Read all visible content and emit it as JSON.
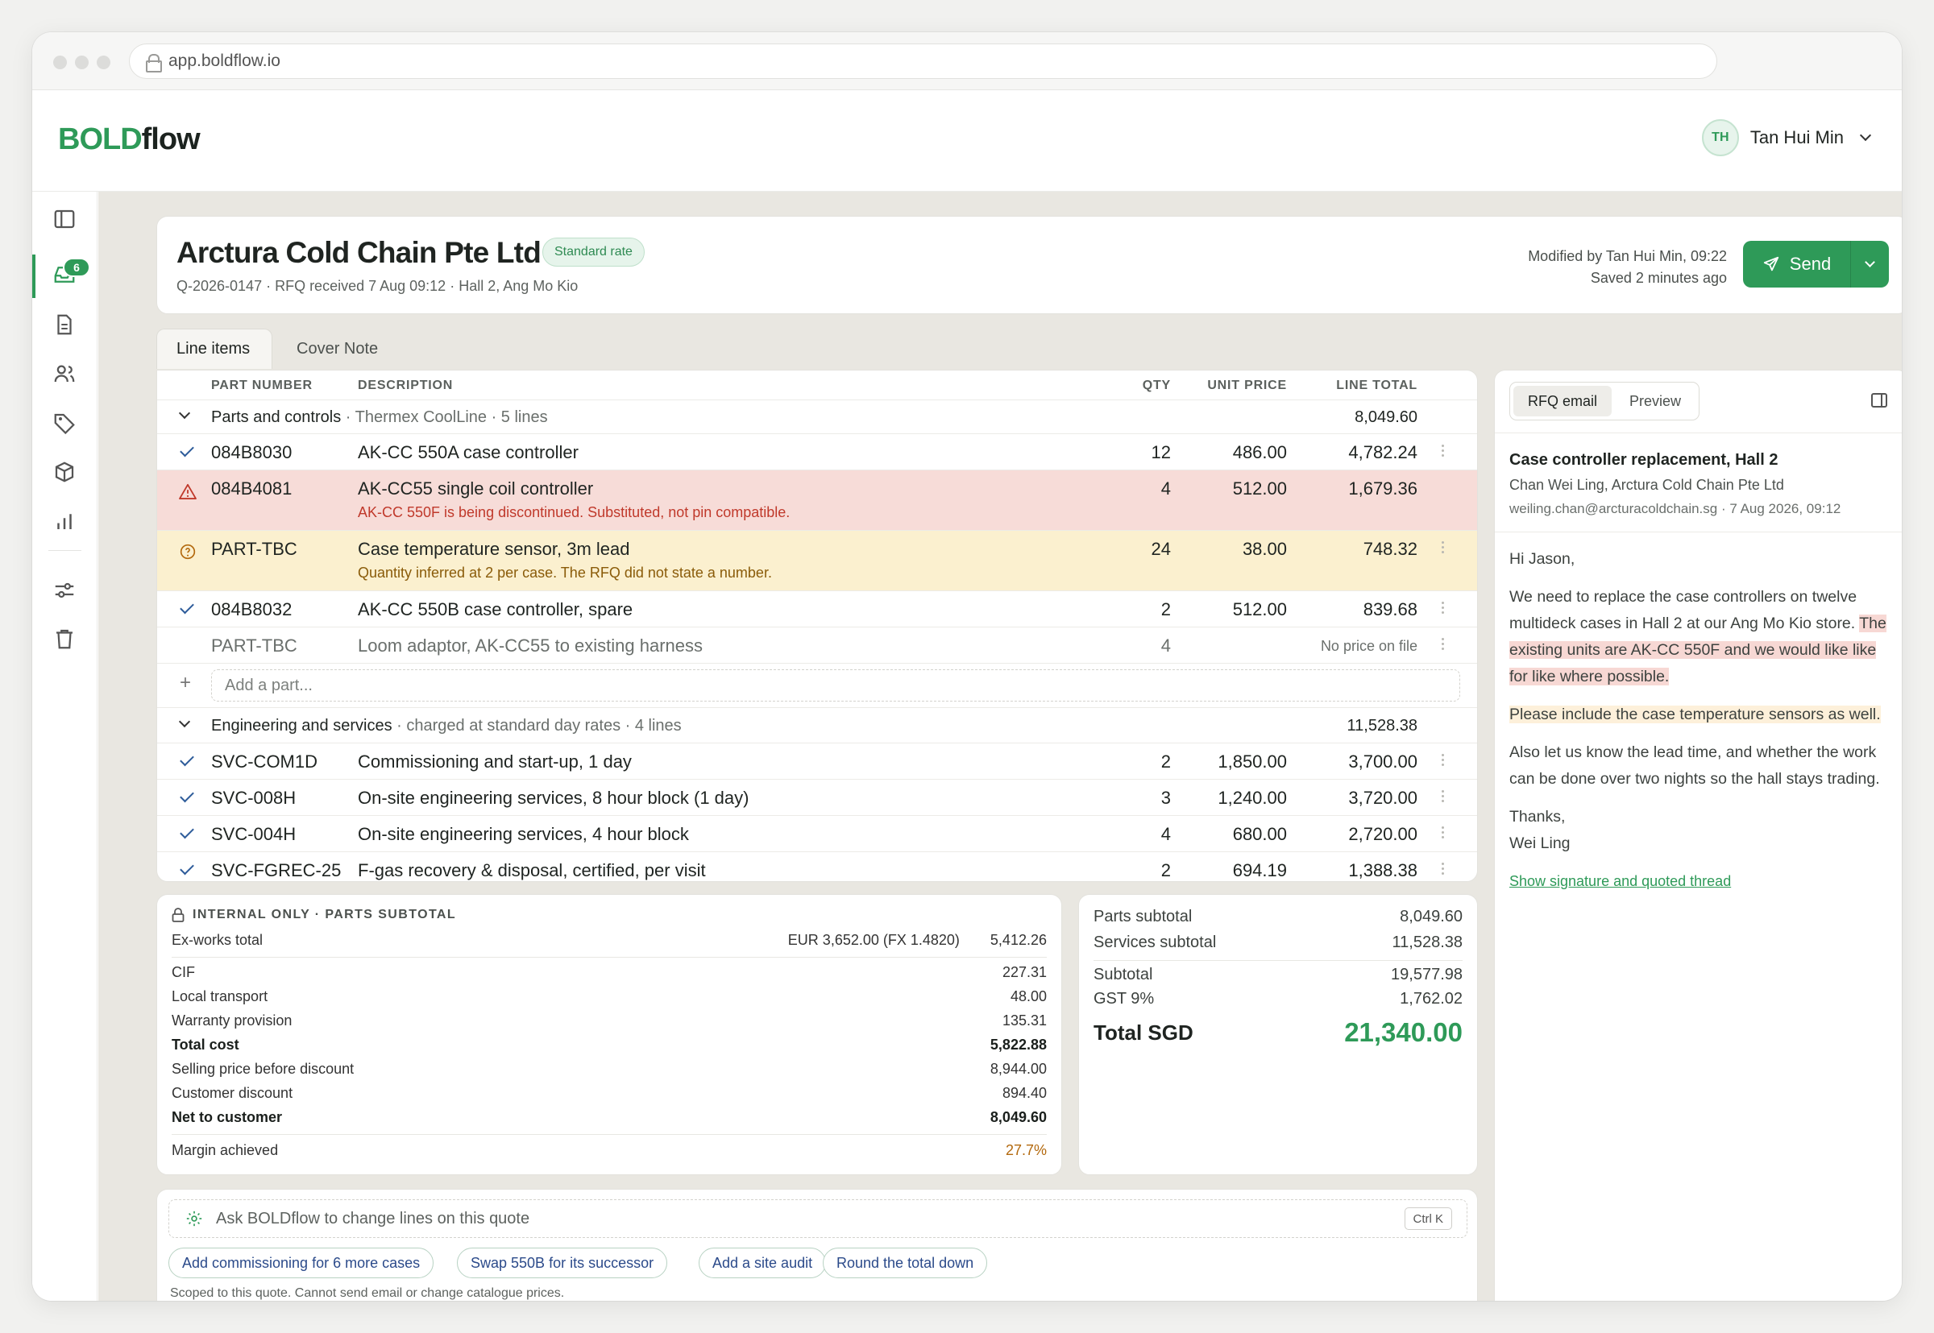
{
  "browser": {
    "url": "app.boldflow.io"
  },
  "app": {
    "logo_bold": "BOLD",
    "logo_flow": "flow",
    "user": {
      "initials": "TH",
      "name": "Tan Hui Min"
    },
    "inbox_badge": "6"
  },
  "quote": {
    "customer": "Arctura Cold Chain Pte Ltd",
    "rate_badge": "Standard rate",
    "subline": "Q-2026-0147 · RFQ received 7 Aug 09:12 · Hall 2, Ang Mo Kio",
    "modified": "Modified by Tan Hui Min, 09:22",
    "saved": "Saved 2 minutes ago",
    "send_label": "Send"
  },
  "tabs": [
    "Line items",
    "Cover Note"
  ],
  "table": {
    "headers": {
      "part": "PART NUMBER",
      "desc": "DESCRIPTION",
      "qty": "QTY",
      "unit": "UNIT PRICE",
      "total": "LINE TOTAL"
    },
    "group1": {
      "name": "Parts and controls",
      "meta": " · Thermex CoolLine · 5 lines",
      "total": "8,049.60"
    },
    "rows1": [
      {
        "part": "084B8030",
        "desc": "AK-CC 550A case controller",
        "qty": "12",
        "unit": "486.00",
        "total": "4,782.24"
      },
      {
        "part": "084B4081",
        "desc": "AK-CC55 single coil controller",
        "note": "AK-CC 550F is being discontinued. Substituted, not pin compatible.",
        "qty": "4",
        "unit": "512.00",
        "total": "1,679.36"
      },
      {
        "part": "PART-TBC",
        "desc": "Case temperature sensor, 3m lead",
        "note": "Quantity inferred at 2 per case. The RFQ did not state a number.",
        "qty": "24",
        "unit": "38.00",
        "total": "748.32"
      },
      {
        "part": "084B8032",
        "desc": "AK-CC 550B case controller, spare",
        "qty": "2",
        "unit": "512.00",
        "total": "839.68"
      },
      {
        "part": "PART-TBC",
        "desc": "Loom adaptor, AK-CC55 to existing harness",
        "qty": "4",
        "unit": "",
        "total": "No price on file"
      }
    ],
    "add_part_placeholder": "Add a part...",
    "group2": {
      "name": "Engineering and services",
      "meta": " · charged at standard day rates · 4 lines",
      "total": "11,528.38"
    },
    "rows2": [
      {
        "part": "SVC-COM1D",
        "desc": "Commissioning and start-up, 1 day",
        "qty": "2",
        "unit": "1,850.00",
        "total": "3,700.00"
      },
      {
        "part": "SVC-008H",
        "desc": "On-site engineering services, 8 hour block (1 day)",
        "qty": "3",
        "unit": "1,240.00",
        "total": "3,720.00"
      },
      {
        "part": "SVC-004H",
        "desc": "On-site engineering services, 4 hour block",
        "qty": "4",
        "unit": "680.00",
        "total": "2,720.00"
      },
      {
        "part": "SVC-FGREC-25",
        "desc": "F-gas recovery & disposal, certified, per visit",
        "qty": "2",
        "unit": "694.19",
        "total": "1,388.38"
      }
    ]
  },
  "internal": {
    "title": "INTERNAL ONLY · PARTS SUBTOTAL",
    "exworks": {
      "label": "Ex-works total",
      "fx": "EUR 3,652.00 (FX 1.4820)",
      "value": "5,412.26"
    },
    "rows": [
      {
        "label": "CIF",
        "value": "227.31"
      },
      {
        "label": "Local transport",
        "value": "48.00"
      },
      {
        "label": "Warranty provision",
        "value": "135.31"
      },
      {
        "label": "Total cost",
        "value": "5,822.88"
      },
      {
        "label": "Selling price before discount",
        "value": "8,944.00"
      },
      {
        "label": "Customer discount",
        "value": "894.40"
      },
      {
        "label": "Net to customer",
        "value": "8,049.60"
      }
    ],
    "margin": {
      "label": "Margin achieved",
      "value": "27.7%"
    }
  },
  "totals": {
    "parts": {
      "label": "Parts subtotal",
      "value": "8,049.60"
    },
    "services": {
      "label": "Services subtotal",
      "value": "11,528.38"
    },
    "subtotal": {
      "label": "Subtotal",
      "value": "19,577.98"
    },
    "gst": {
      "label": "GST 9%",
      "value": "1,762.02"
    },
    "total": {
      "label": "Total SGD",
      "value": "21,340.00"
    }
  },
  "assistant": {
    "placeholder": "Ask BOLDflow to change lines on this quote",
    "shortcut": "Ctrl K",
    "chips": [
      "Add commissioning for 6 more cases",
      "Swap 550B for its successor",
      "Add a site audit",
      "Round the total down"
    ],
    "scope_note": "Scoped to this quote. Cannot send email or change catalogue prices."
  },
  "email": {
    "tabs": [
      "RFQ email",
      "Preview"
    ],
    "subject": "Case controller replacement, Hall 2",
    "from": "Chan Wei Ling, Arctura Cold Chain Pte Ltd",
    "address": "weiling.chan@arcturacoldchain.sg · 7 Aug 2026, 09:12",
    "greeting": "Hi Jason,",
    "p1a": "We need to replace the case controllers on twelve multideck cases in Hall 2 at our Ang Mo Kio store. ",
    "p1b": "The existing units are AK-CC 550F and we would like like for like where possible.",
    "p2": "Please include the case temperature sensors as well.",
    "p3": "Also let us know the lead time, and whether the work can be done over two nights so the hall stays trading.",
    "signoff": "Thanks,",
    "signname": "Wei Ling",
    "link": "Show signature and quoted thread"
  },
  "colors": {
    "accent": "#2e9a58",
    "error_row": "#f7dcd8",
    "warn_row": "#fbf0cf",
    "margin": "#b3690e"
  }
}
